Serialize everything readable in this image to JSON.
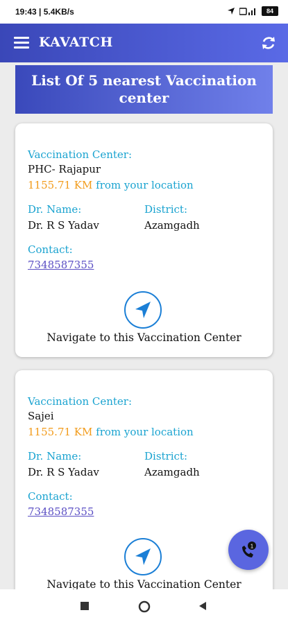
{
  "status_bar": {
    "time_speed": "19:43 | 5.4KB/s",
    "battery": "84"
  },
  "app_bar": {
    "title": "KAVATCH"
  },
  "banner": {
    "line1": "List Of  5 nearest Vaccination",
    "line2": "center"
  },
  "labels": {
    "center": "Vaccination Center:",
    "doctor": "Dr. Name:",
    "district": "District:",
    "contact": "Contact:",
    "from_location": "from your location",
    "navigate": "Navigate to this Vaccination Center"
  },
  "centers": [
    {
      "name": "PHC- Rajapur",
      "distance": "1155.71 KM",
      "doctor": "Dr. R S Yadav",
      "district": "Azamgadh",
      "contact": "7348587355"
    },
    {
      "name": "Sajei",
      "distance": "1155.71 KM",
      "doctor": "Dr. R S Yadav",
      "district": "Azamgadh",
      "contact": "7348587355"
    }
  ],
  "colors": {
    "accent_blue": "#1aa3d0",
    "distance_orange": "#f29b1a",
    "appbar": "#3a47b8",
    "fab": "#5a66e0"
  },
  "icons": {
    "menu": "hamburger-menu-icon",
    "refresh": "refresh-icon",
    "navigate": "navigation-arrow-icon",
    "fab": "phone-call-icon"
  }
}
